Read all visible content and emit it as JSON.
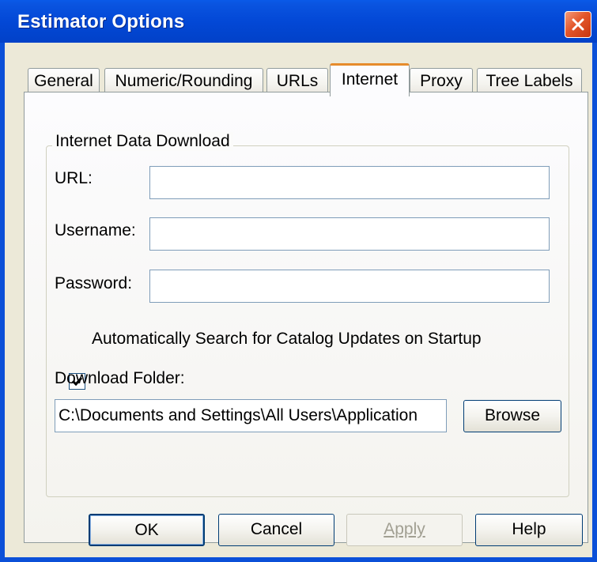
{
  "window": {
    "title": "Estimator Options"
  },
  "tabs": [
    {
      "label": "General",
      "active": false
    },
    {
      "label": "Numeric/Rounding",
      "active": false
    },
    {
      "label": "URLs",
      "active": false
    },
    {
      "label": "Internet",
      "active": true
    },
    {
      "label": "Proxy",
      "active": false
    },
    {
      "label": "Tree Labels",
      "active": false
    }
  ],
  "internet": {
    "group_title": "Internet Data Download",
    "url_label": "URL:",
    "url_value": "",
    "username_label": "Username:",
    "username_value": "",
    "password_label": "Password:",
    "password_value": "",
    "auto_search_label": "Automatically Search for Catalog Updates on Startup",
    "auto_search_checked": true,
    "download_folder_label": "Download Folder:",
    "download_folder_value": "C:\\Documents and Settings\\All Users\\Application",
    "browse_label": "Browse"
  },
  "buttons": {
    "ok": "OK",
    "cancel": "Cancel",
    "apply": "Apply",
    "help": "Help"
  },
  "colors": {
    "titlebar": "#0348d6",
    "dialog_face": "#ece9d8",
    "active_tab_accent": "#e68b2c",
    "close_button": "#e3562a"
  },
  "icons": {
    "close": "close-icon",
    "check": "check-icon"
  }
}
